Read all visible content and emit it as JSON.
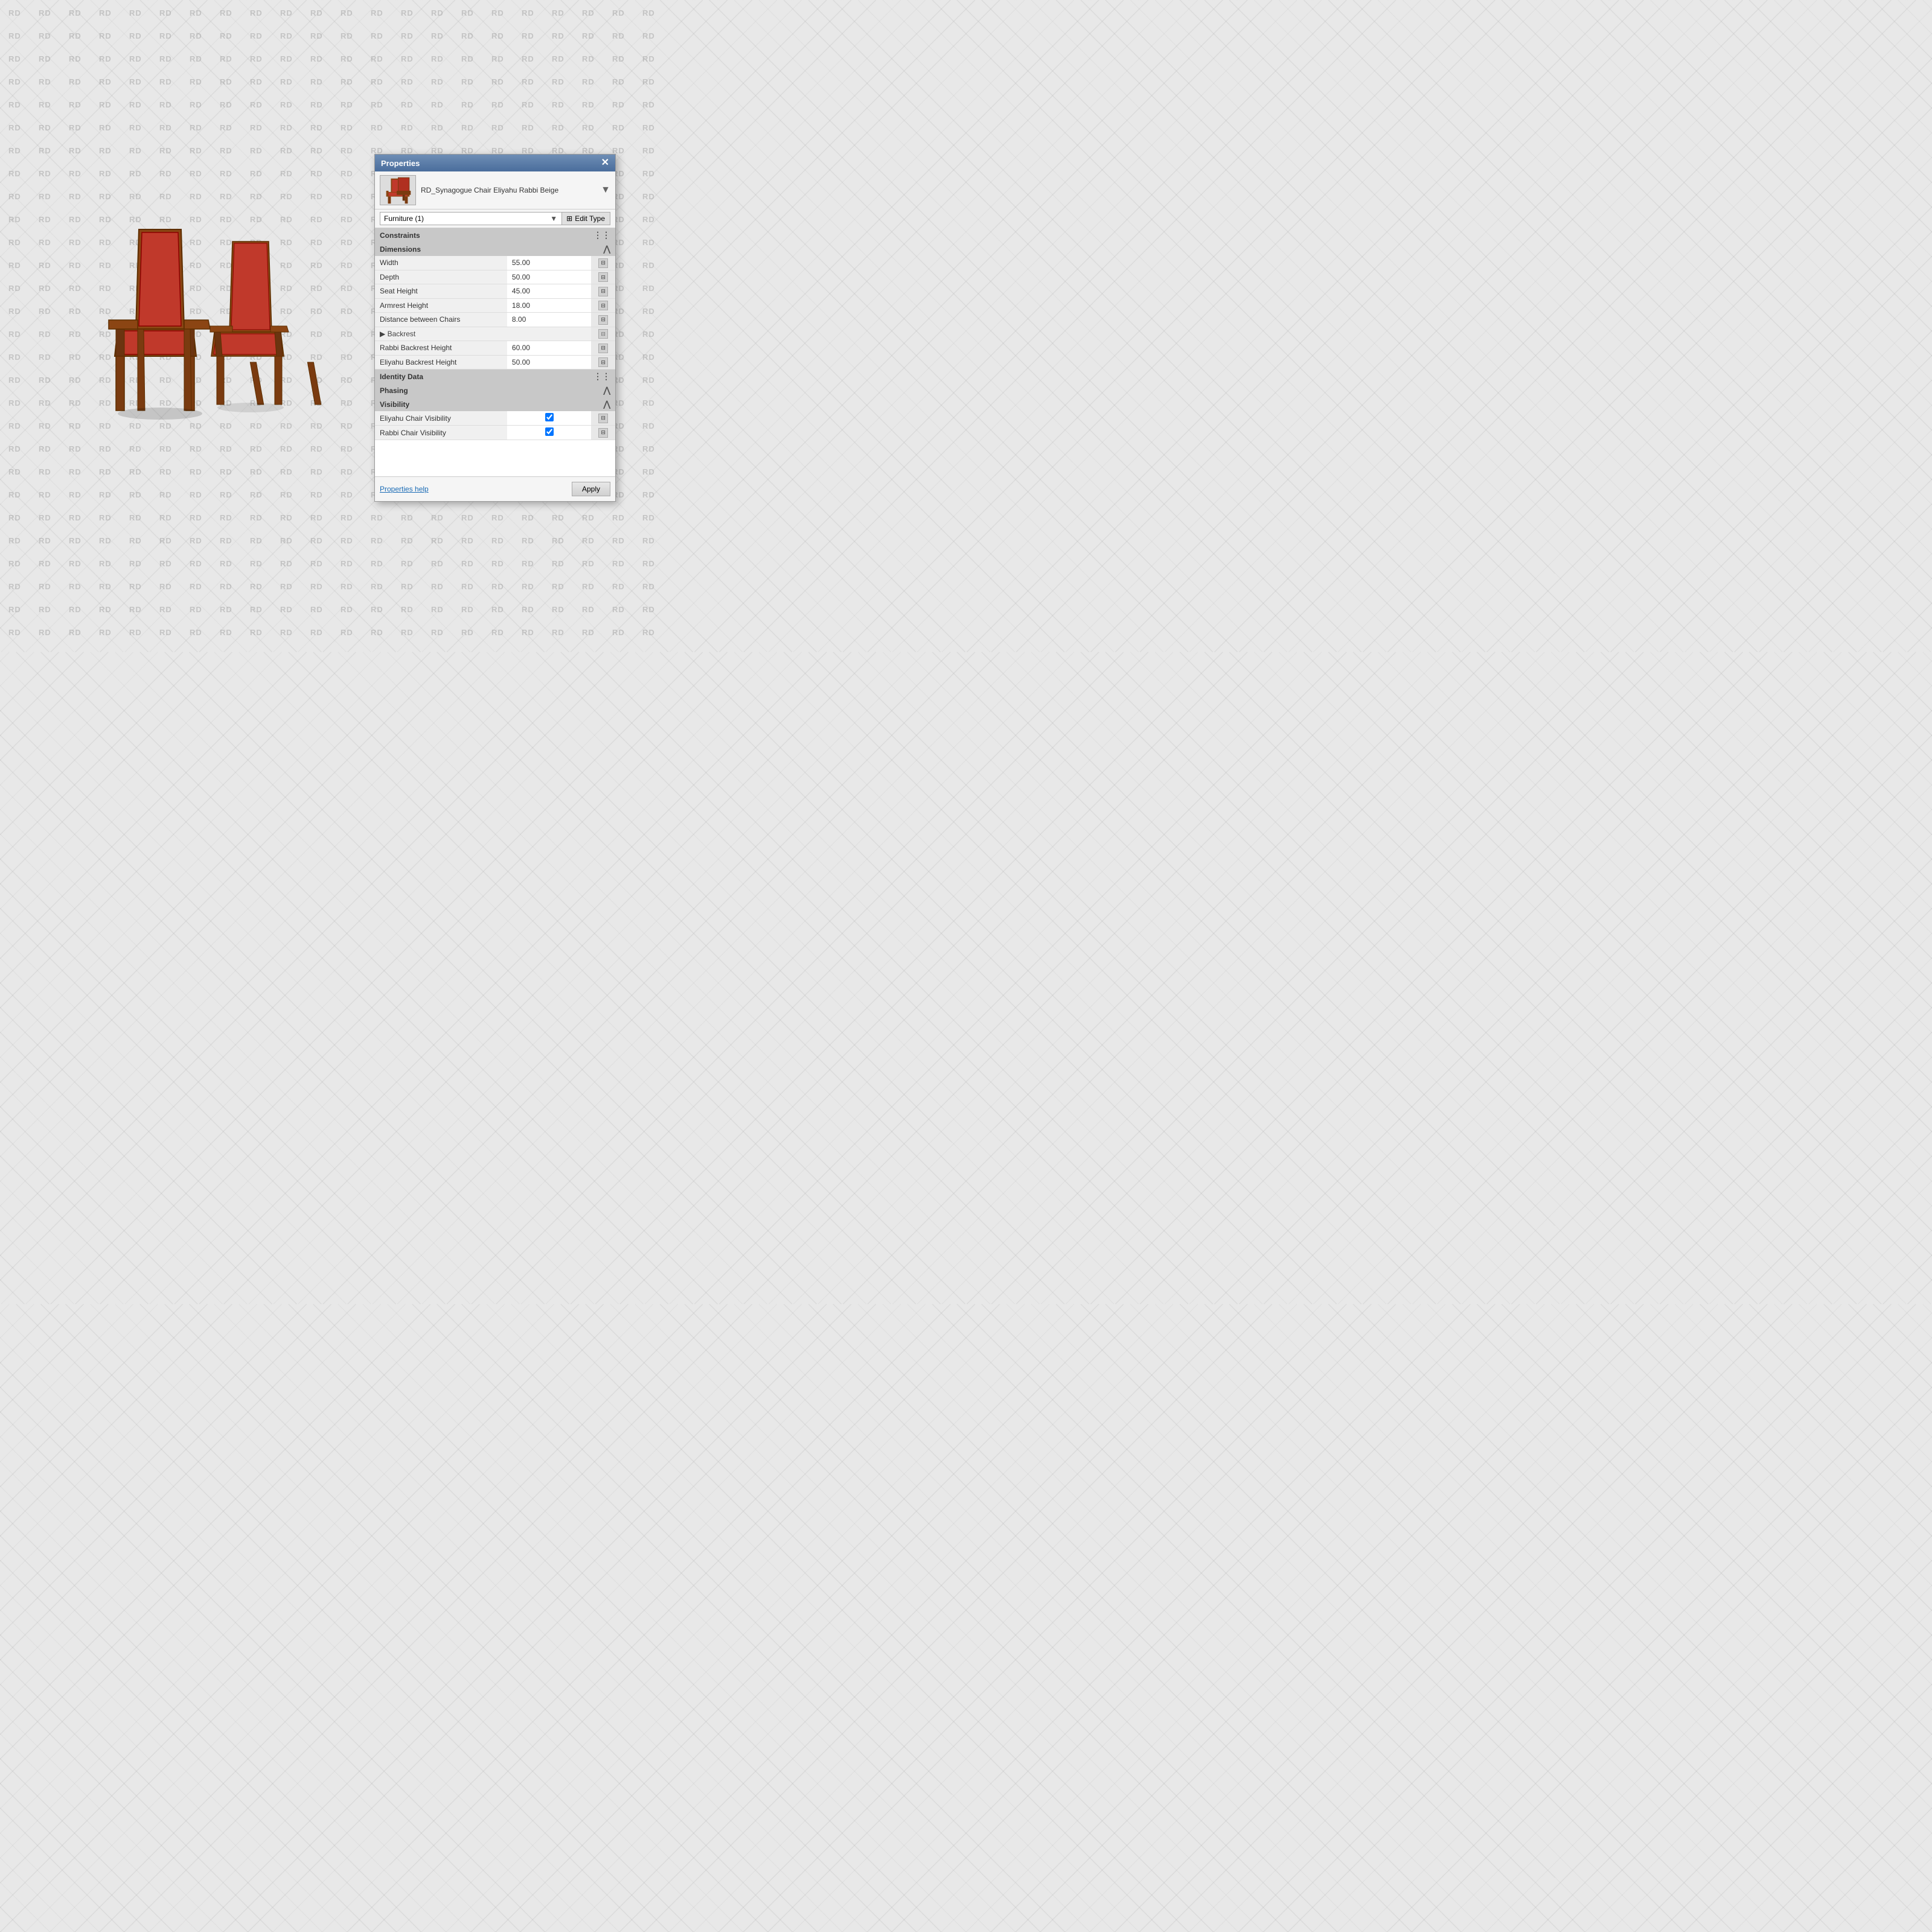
{
  "watermark": {
    "text": "RD"
  },
  "panel": {
    "title": "Properties",
    "close_icon": "✕",
    "item_name": "RD_Synagogue Chair Eliyahu Rabbi Beige",
    "dropdown_arrow": "▼",
    "type_selector": {
      "label": "Furniture (1)",
      "options": [
        "Furniture (1)"
      ]
    },
    "edit_type_btn": "Edit Type",
    "sections": {
      "constraints": {
        "label": "Constraints",
        "collapsed": true
      },
      "dimensions": {
        "label": "Dimensions",
        "properties": [
          {
            "name": "Width",
            "value": "55.00"
          },
          {
            "name": "Depth",
            "value": "50.00"
          },
          {
            "name": "Seat Height",
            "value": "45.00"
          },
          {
            "name": "Armrest Height",
            "value": "18.00"
          },
          {
            "name": "Distance between Chairs",
            "value": "8.00"
          },
          {
            "name": "Backrest",
            "value": "",
            "group": true
          },
          {
            "name": "Rabbi Backrest Height",
            "value": "60.00"
          },
          {
            "name": "Eliyahu Backrest Height",
            "value": "50.00"
          }
        ]
      },
      "identity_data": {
        "label": "Identity Data",
        "collapsed": true
      },
      "phasing": {
        "label": "Phasing",
        "collapsed": true
      },
      "visibility": {
        "label": "Visibility",
        "properties": [
          {
            "name": "Eliyahu Chair Visibility",
            "value": true
          },
          {
            "name": "Rabbi Chair Visibility",
            "value": true
          }
        ]
      }
    },
    "footer": {
      "help_link": "Properties help",
      "apply_btn": "Apply"
    }
  }
}
